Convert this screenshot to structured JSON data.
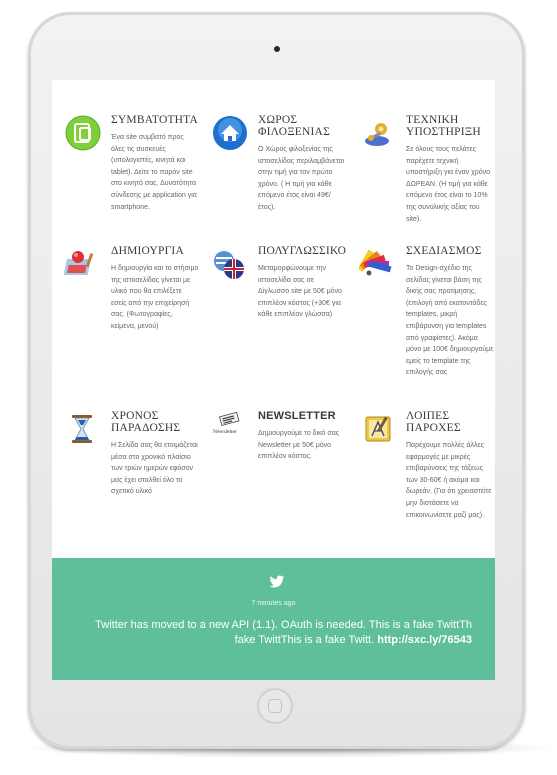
{
  "features": [
    {
      "title": "ΣΥΜΒΑΤΟΤΗΤΑ",
      "icon": "tablet-icon",
      "text": "Ένα site συμβατό προς όλες τις συσκευές (υπολογιστές, κινητά και tablet). Δείτε το παρόν site στο κινητό σας. Δυνατότητα σύνδεσης με application για smartphone."
    },
    {
      "title": "ΧΩΡΟΣ ΦΙΛΟΞΕΝΙΑΣ",
      "icon": "home-icon",
      "text": "Ο Χώρος φιλοξενίας της ιστοσελίδας περιλαμβάνεται στην τιμή για τον πρώτο χρόνο. ( Η τιμή για κάθε επόμενο έτος είναι 49€/έτος)."
    },
    {
      "title": "ΤΕΧΝΙΚΗ ΥΠΟΣΤΗΡΙΞΗ",
      "icon": "support-icon",
      "text": "Σε όλους τους πελάτες παρέχετε τεχνική υποστήριξη για έναν χρόνο ΔΩΡΕΑΝ. (Η τιμή για κάθε επόμενο έτος είναι το 10% της συνολικής αξίας του site)."
    },
    {
      "title": "ΔΗΜΙΟΥΡΓΙΑ",
      "icon": "paint-icon",
      "text": "Η δημιουργία και το στήσιμο της ιστοσελίδας γίνεται με υλικό που θα επιλέξετε εσείς από την επιχείρησή σας. (Φωτογραφίες, κείμενα, μενού)"
    },
    {
      "title": "ΠΟΛΥΓΛΩΣΣΙΚΟ",
      "icon": "flags-icon",
      "text": "Μεταμορφώνουμε την ιστοσελίδα σας σε Δίγλωσσο site με 50€ μόνο επιπλέον κόστος (+30€ για κάθε επιπλέον γλώσσα)"
    },
    {
      "title": "ΣΧΕΔΙΑΣΜΟΣ",
      "icon": "color-palette-icon",
      "text": "Το Design-σχέδιο της σελίδας γίνεται βάση της δικής σας προτίμησης, (επιλογή από εκατοντάδες templates, μικρή επιβάρυνση για templates από γραφίστες). Ακόμα μόνο με 100€ δημιουργούμε εμείς το template της επιλογής σας"
    },
    {
      "title": "ΧΡΟΝΟΣ ΠΑΡΑΔΟΣΗΣ",
      "icon": "hourglass-icon",
      "text": "Η Σελίδα σας θα ετοιμάζεται μέσα στο χρονικό πλαίσιο των τριών ημερών εφόσον μας έχει σταλθεί όλο το σχετικό υλικό"
    },
    {
      "title": "NEWSLETTER",
      "icon": "newsletter-icon",
      "icon_caption": "Newsletter",
      "text": "Δημιουργούμε το δικό σας Newsletter με 50€ μόνο επιπλέον κόστος."
    },
    {
      "title": "ΛΟΙΠΕΣ ΠΑΡΟΧΕΣ",
      "icon": "design-tools-icon",
      "text": "Παρέχουμε πολλές άλλες εφαρμογές με μικρές επιβαρύνσεις της τάξεως των 30-60€ ή ακόμα και δωρεάν. (Για ότι χρειαστείτε μην διστάσετε να επικοινωνίσετε μαζί μας)."
    }
  ],
  "twitter": {
    "time": "7 minutes ago",
    "text": "Twitter has moved to a new API (1.1). OAuth is needed. This is a fake TwittTh fake TwittThis is a fake Twitt.",
    "link": "http://sxc.ly/76543"
  },
  "colors": {
    "twitter_bg": "#5fbf9b",
    "text": "#666666",
    "heading": "#3a3a3a"
  }
}
